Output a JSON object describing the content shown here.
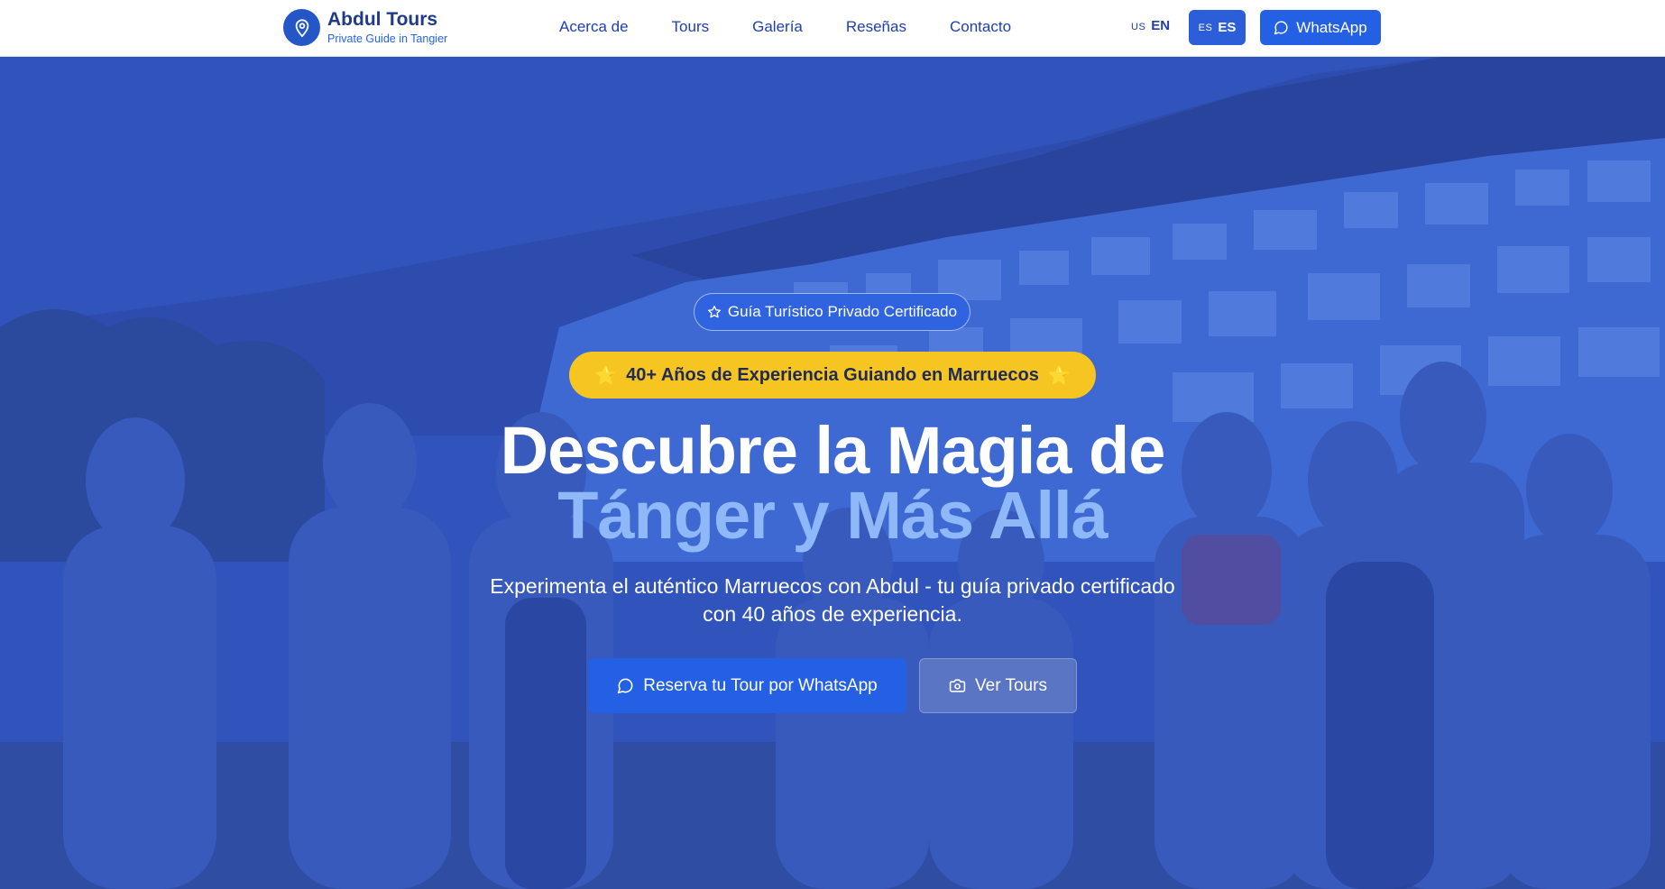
{
  "brand": {
    "title": "Abdul Tours",
    "subtitle": "Private Guide in Tangier",
    "logo_icon": "map-pin-icon"
  },
  "nav": {
    "links": [
      "Acerca de",
      "Tours",
      "Galería",
      "Reseñas",
      "Contacto"
    ]
  },
  "language": {
    "en": {
      "flag": "US",
      "code": "EN",
      "active": false
    },
    "es": {
      "flag": "ES",
      "code": "ES",
      "active": true
    }
  },
  "whatsapp_nav": {
    "label": "WhatsApp",
    "icon": "message-circle-icon"
  },
  "hero": {
    "certified_badge": "Guía Turístico Privado Certificado",
    "experience_badge": "40+ Años de Experiencia Guiando en Marruecos",
    "title_line1": "Descubre la Magia de",
    "title_line2": "Tánger y Más Allá",
    "subtitle": "Experimenta el auténtico Marruecos con Abdul - tu guía privado certificado con 40 años de experiencia.",
    "cta_primary": "Reserva tu Tour por WhatsApp",
    "cta_secondary": "Ver Tours"
  },
  "colors": {
    "brand_blue": "#1e3a8a",
    "accent_blue": "#2460e3",
    "badge_yellow": "#f7c522",
    "title_highlight": "#8fb8f8"
  }
}
